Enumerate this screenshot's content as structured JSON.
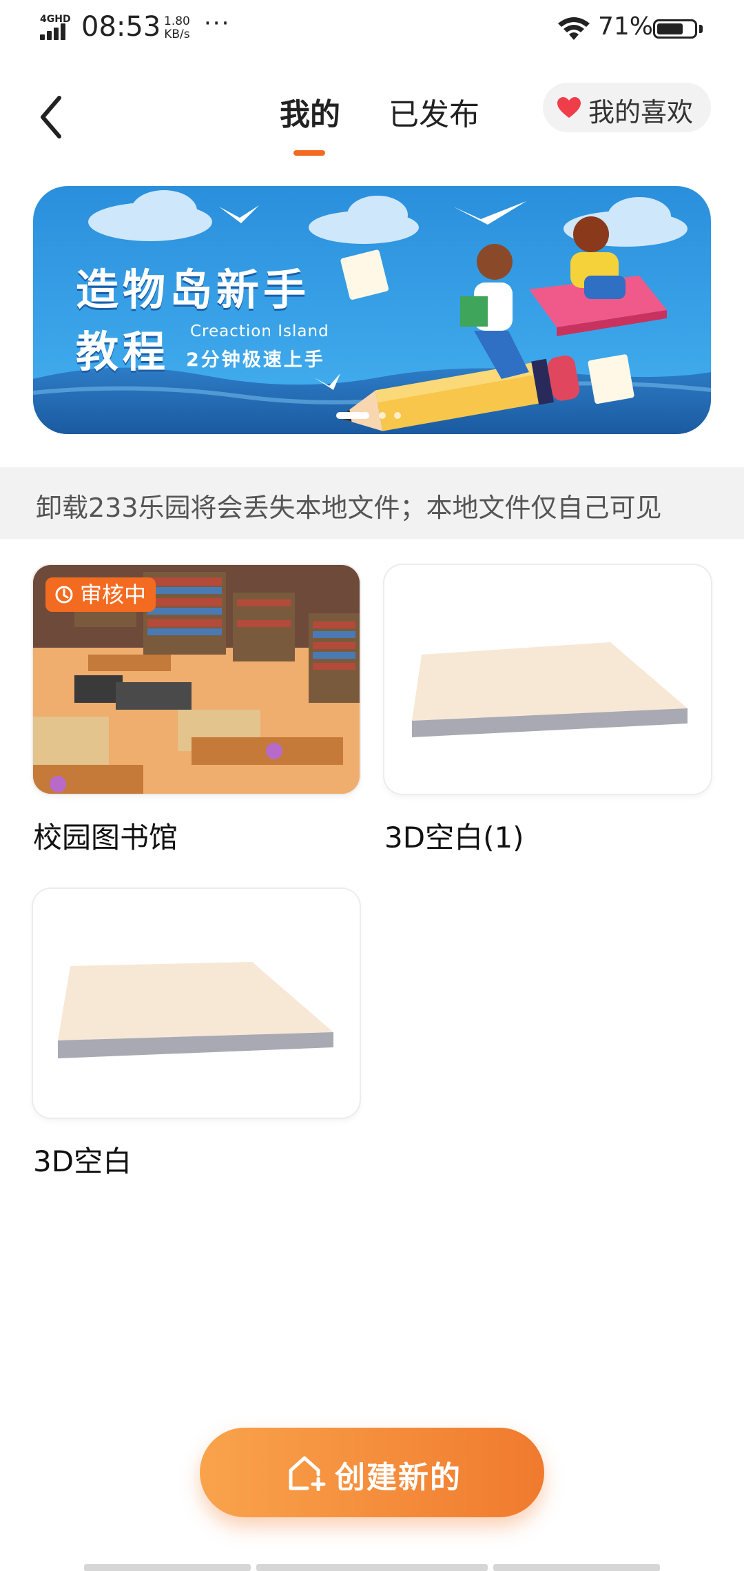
{
  "status_bar": {
    "network": "4GHD",
    "time": "08:53",
    "speed_value": "1.80",
    "speed_unit": "KB/s",
    "more": "···",
    "battery_percent": "71%",
    "battery_level": 0.71
  },
  "header": {
    "tabs": [
      {
        "label": "我的",
        "active": true
      },
      {
        "label": "已发布",
        "active": false
      }
    ],
    "favorites_label": "我的喜欢"
  },
  "banner": {
    "title_line1": "造物岛新手",
    "title_line2": "教程",
    "english": "Creaction Island",
    "subtitle": "2分钟极速上手",
    "page_count": 3,
    "active_page": 0
  },
  "notice": "卸载233乐园将会丢失本地文件；本地文件仅自己可见",
  "projects": [
    {
      "title": "校园图书馆",
      "badge": "审核中",
      "thumb": "library-scene"
    },
    {
      "title": "3D空白(1)",
      "thumb": "blank-slab"
    },
    {
      "title": "3D空白",
      "thumb": "blank-slab"
    }
  ],
  "create_button_label": "创建新的",
  "colors": {
    "accent": "#f36b21",
    "banner_sky": "#2e95e0",
    "notice_bg": "#f2f2f2"
  },
  "icons": [
    "back-arrow-icon",
    "heart-icon",
    "clock-icon",
    "add-home-icon",
    "wifi-icon",
    "battery-icon",
    "signal-icon"
  ]
}
